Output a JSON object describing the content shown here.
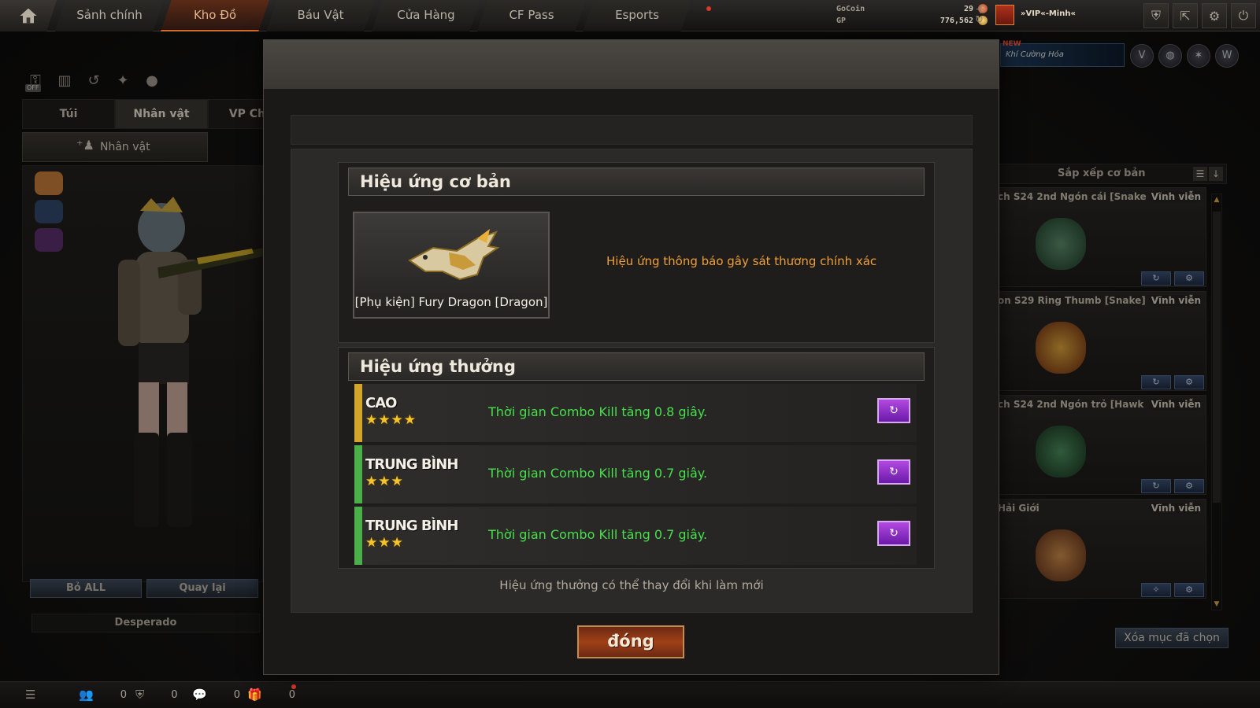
{
  "nav": {
    "items": [
      "Sảnh chính",
      "Kho Đồ",
      "Báu Vật",
      "Cửa Hàng",
      "CF Pass",
      "Esports"
    ],
    "active": "Kho Đồ"
  },
  "currency": {
    "gocoin_label": "GoCoin",
    "gocoin_value": "29",
    "gp_label": "GP",
    "gp_value": "776,562"
  },
  "user": {
    "name": "»VIP«-Minh«"
  },
  "left": {
    "tabs": [
      "Túi",
      "Nhân vật",
      "VP Chức"
    ],
    "sub_tab": "Nhân vật",
    "buttons": [
      "Bỏ ALL",
      "Quay lại"
    ],
    "character_name": "Desperado",
    "tool_off_badge": "OFF"
  },
  "right": {
    "promo_badge": "NEW",
    "promo_text": "Khí Cường Hóa",
    "sort_label": "Sắp xếp cơ bản",
    "items": [
      {
        "name": "ch S24 2nd Ngón cái [Snake",
        "duration": "Vĩnh viễn"
      },
      {
        "name": "on S29 Ring Thumb [Snake]",
        "duration": "Vĩnh viễn"
      },
      {
        "name": "ch S24 2nd Ngón trỏ [Hawk",
        "duration": "Vĩnh viễn"
      },
      {
        "name": "Hải Giới",
        "duration": "Vĩnh viễn"
      }
    ],
    "clear_button": "Xóa mục đã chọn"
  },
  "modal": {
    "base_section_title": "Hiệu ứng cơ bản",
    "item_caption": "[Phụ kiện] Fury Dragon [Dragon]",
    "base_effect_desc": "Hiệu ứng thông báo gây sát thương chính xác",
    "bonus_section_title": "Hiệu ứng thưởng",
    "effects": [
      {
        "tier": "CAO",
        "stars": "★★★★",
        "desc": "Thời gian Combo Kill tăng 0.8 giây."
      },
      {
        "tier": "TRUNG BÌNH",
        "stars": "★★★",
        "desc": "Thời gian Combo Kill tăng 0.7 giây."
      },
      {
        "tier": "TRUNG BÌNH",
        "stars": "★★★",
        "desc": "Thời gian Combo Kill tăng 0.7 giây."
      }
    ],
    "note": "Hiệu ứng thưởng có thể thay đổi khi làm mới",
    "close_label": "đóng"
  },
  "bottom": {
    "counts": [
      "0",
      "0",
      "0",
      "0"
    ]
  },
  "colors": {
    "accent": "#d2692a",
    "high_tier": "#d3a52b",
    "mid_tier": "#4bb04a",
    "effect_text": "#45e04b",
    "base_desc": "#f0a03a"
  }
}
